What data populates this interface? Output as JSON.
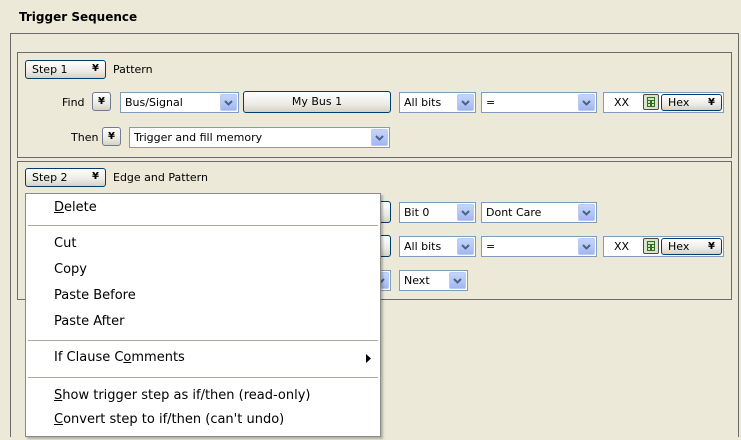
{
  "title": "Trigger Sequence",
  "step1": {
    "button_label": "Step 1",
    "type_label": "Pattern",
    "find_label": "Find",
    "source_value": "Bus/Signal",
    "bus_button_label": "My Bus 1",
    "bits_value": "All bits",
    "operator_value": "=",
    "value_text": "XX",
    "format_label": "Hex",
    "then_label": "Then",
    "action_value": "Trigger and fill memory"
  },
  "step2": {
    "button_label": "Step 2",
    "type_label": "Edge and Pattern",
    "row1_bits_value": "Bit 0",
    "row1_condition_value": "Dont Care",
    "row2_bits_value": "All bits",
    "row2_operator_value": "=",
    "row2_value_text": "XX",
    "row2_format_label": "Hex",
    "row3_next_value": "Next"
  },
  "context_menu": {
    "delete": {
      "pre": "",
      "u": "D",
      "post": "elete"
    },
    "cut": "Cut",
    "copy": "Copy",
    "paste_before": "Paste Before",
    "paste_after": "Paste After",
    "if_clause_comments": {
      "pre": "If Clause C",
      "u": "o",
      "post": "mments"
    },
    "show_as_ifthen": {
      "pre": "",
      "u": "S",
      "post": "how trigger step as if/then (read-only)"
    },
    "convert_to_ifthen": {
      "pre": "",
      "u": "C",
      "post": "onvert step to if/then (can't undo)"
    }
  },
  "icons": {
    "dropdown_arrow": "chevron-down-icon",
    "double_chevron": "double-chevron-down-icon",
    "calculator": "calculator-icon",
    "submenu": "submenu-arrow-icon"
  },
  "colors": {
    "background": "#ece9d8",
    "combo_border": "#7f9db9",
    "combo_arrow": "#b5c8f7",
    "button_border": "#003c74",
    "menu_background": "#ffffff"
  }
}
